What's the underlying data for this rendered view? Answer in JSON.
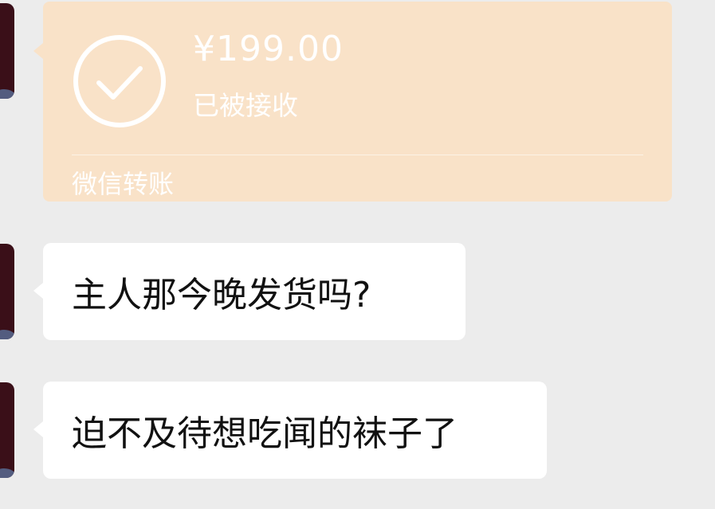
{
  "transfer": {
    "amount": "¥199.00",
    "status": "已被接收",
    "footer": "微信转账",
    "icon": "check-circle-icon",
    "background_color": "#f9e2c8"
  },
  "messages": [
    {
      "text": "主人那今晚发货吗?"
    },
    {
      "text": "迫不及待想吃闻的袜子了"
    }
  ],
  "colors": {
    "chat_background": "#ececec",
    "bubble_background": "#ffffff",
    "text": "#111111"
  }
}
